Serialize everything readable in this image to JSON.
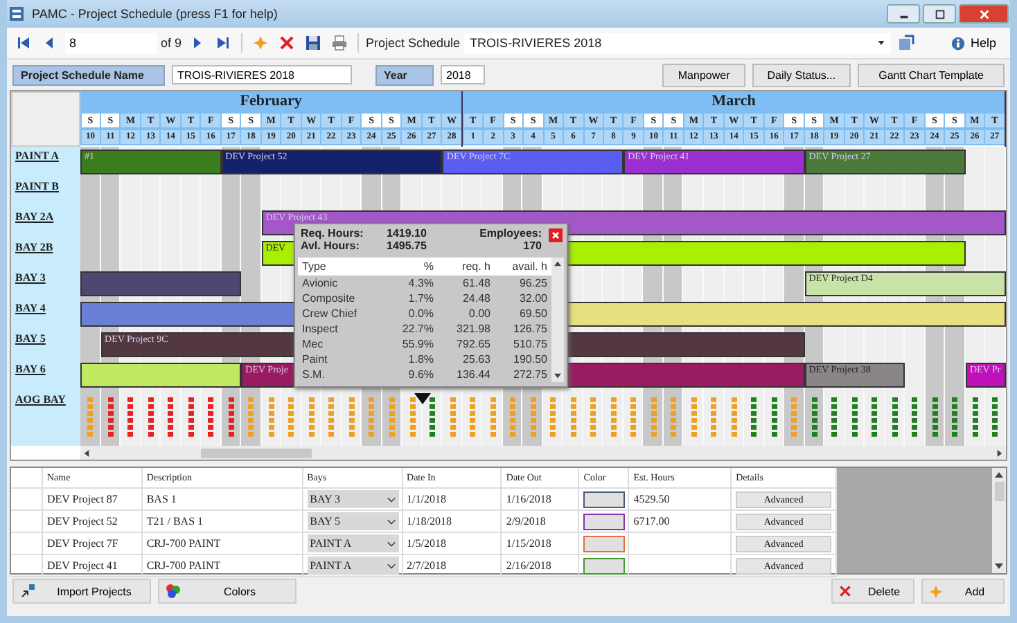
{
  "window": {
    "title": "PAMC - Project Schedule (press F1 for help)"
  },
  "toolbar": {
    "record": "8",
    "record_count": "of 9",
    "schedule_label": "Project Schedule",
    "schedule_value": "TROIS-RIVIERES 2018",
    "help": "Help"
  },
  "form": {
    "name_label": "Project Schedule Name",
    "name_value": "TROIS-RIVIERES 2018",
    "year_label": "Year",
    "year_value": "2018",
    "buttons": [
      "Manpower",
      "Daily Status...",
      "Gantt Chart Template"
    ]
  },
  "gantt": {
    "months": [
      {
        "name": "February",
        "days": [
          {
            "letter": "S",
            "number": "10",
            "weekend": true
          },
          {
            "letter": "S",
            "number": "11",
            "weekend": true
          },
          {
            "letter": "M",
            "number": "12",
            "weekend": false
          },
          {
            "letter": "T",
            "number": "13",
            "weekend": false
          },
          {
            "letter": "W",
            "number": "14",
            "weekend": false
          },
          {
            "letter": "T",
            "number": "15",
            "weekend": false
          },
          {
            "letter": "F",
            "number": "16",
            "weekend": false
          },
          {
            "letter": "S",
            "number": "17",
            "weekend": true
          },
          {
            "letter": "S",
            "number": "18",
            "weekend": true
          },
          {
            "letter": "M",
            "number": "19",
            "weekend": false
          },
          {
            "letter": "T",
            "number": "20",
            "weekend": false
          },
          {
            "letter": "W",
            "number": "21",
            "weekend": false
          },
          {
            "letter": "T",
            "number": "22",
            "weekend": false
          },
          {
            "letter": "F",
            "number": "23",
            "weekend": false
          },
          {
            "letter": "S",
            "number": "24",
            "weekend": true
          },
          {
            "letter": "S",
            "number": "25",
            "weekend": true
          },
          {
            "letter": "M",
            "number": "26",
            "weekend": false
          },
          {
            "letter": "T",
            "number": "27",
            "weekend": false
          },
          {
            "letter": "W",
            "number": "28",
            "weekend": false
          }
        ]
      },
      {
        "name": "March",
        "days": [
          {
            "letter": "T",
            "number": "1",
            "weekend": false
          },
          {
            "letter": "F",
            "number": "2",
            "weekend": false
          },
          {
            "letter": "S",
            "number": "3",
            "weekend": true
          },
          {
            "letter": "S",
            "number": "4",
            "weekend": true
          },
          {
            "letter": "M",
            "number": "5",
            "weekend": false
          },
          {
            "letter": "T",
            "number": "6",
            "weekend": false
          },
          {
            "letter": "W",
            "number": "7",
            "weekend": false
          },
          {
            "letter": "T",
            "number": "8",
            "weekend": false
          },
          {
            "letter": "F",
            "number": "9",
            "weekend": false
          },
          {
            "letter": "S",
            "number": "10",
            "weekend": true
          },
          {
            "letter": "S",
            "number": "11",
            "weekend": true
          },
          {
            "letter": "M",
            "number": "12",
            "weekend": false
          },
          {
            "letter": "T",
            "number": "13",
            "weekend": false
          },
          {
            "letter": "W",
            "number": "14",
            "weekend": false
          },
          {
            "letter": "T",
            "number": "15",
            "weekend": false
          },
          {
            "letter": "F",
            "number": "16",
            "weekend": false
          },
          {
            "letter": "S",
            "number": "17",
            "weekend": true
          },
          {
            "letter": "S",
            "number": "18",
            "weekend": true
          },
          {
            "letter": "M",
            "number": "19",
            "weekend": false
          },
          {
            "letter": "T",
            "number": "20",
            "weekend": false
          },
          {
            "letter": "W",
            "number": "21",
            "weekend": false
          },
          {
            "letter": "T",
            "number": "22",
            "weekend": false
          },
          {
            "letter": "F",
            "number": "23",
            "weekend": false
          },
          {
            "letter": "S",
            "number": "24",
            "weekend": true
          },
          {
            "letter": "S",
            "number": "25",
            "weekend": true
          },
          {
            "letter": "M",
            "number": "26",
            "weekend": false
          },
          {
            "letter": "T",
            "number": "27",
            "weekend": false
          }
        ]
      }
    ],
    "rows": [
      {
        "label": "PAINT A",
        "bars": [
          {
            "label": "#1",
            "color": "#3a7d1c"
          },
          {
            "label": "DEV Project 52",
            "color": "#14206a"
          },
          {
            "label": "DEV Project 7C",
            "color": "#5a5ef0"
          },
          {
            "label": "DEV Project 41",
            "color": "#9a30d0"
          },
          {
            "label": "DEV Project 27",
            "color": "#4a7a3a"
          }
        ]
      },
      {
        "label": "PAINT B",
        "bars": []
      },
      {
        "label": "BAY 2A",
        "bars": [
          {
            "label": "DEV Project 43",
            "color": "#a458c8"
          }
        ]
      },
      {
        "label": "BAY 2B",
        "bars": [
          {
            "label": "DEV",
            "color": "#a8f000"
          }
        ]
      },
      {
        "label": "BAY 3",
        "bars": [
          {
            "color": "#4e4870"
          },
          {
            "label": "DEV Project D4",
            "color": "#c8e2a8"
          }
        ]
      },
      {
        "label": "BAY 4",
        "bars": [
          {
            "color": "#6a80d8"
          },
          {
            "color": "#e8e080"
          }
        ]
      },
      {
        "label": "BAY 5",
        "bars": [
          {
            "label": "DEV Project 9C",
            "color": "#533842"
          }
        ]
      },
      {
        "label": "BAY 6",
        "bars": [
          {
            "color": "#c0e860"
          },
          {
            "label": "DEV Proje",
            "color": "#9a1c60"
          },
          {
            "label": "DEV Project 38",
            "color": "#8a8688"
          },
          {
            "label": "DEV Pr",
            "color": "#c010b8"
          }
        ]
      }
    ],
    "aog": {
      "label": "AOG BAY",
      "marks": [
        {
          "color": "#f0a020"
        },
        {
          "color": "#e82020"
        },
        {
          "color": "#e82020"
        },
        {
          "color": "#e82020"
        },
        {
          "color": "#e82020"
        },
        {
          "color": "#e82020"
        },
        {
          "color": "#e82020"
        },
        {
          "color": "#e82020"
        },
        {
          "color": "#f0a020"
        },
        {
          "color": "#f0a020"
        },
        {
          "color": "#f0a020"
        },
        {
          "color": "#f0a020"
        },
        {
          "color": "#f0a020"
        },
        {
          "color": "#f0a020"
        },
        {
          "color": "#f0a020"
        },
        {
          "color": "#f0a020"
        },
        {
          "color": "#f0a020"
        },
        {
          "color": "#208020"
        },
        {
          "color": "#f0a020"
        },
        {
          "color": "#f0a020"
        },
        {
          "color": "#f0a020"
        },
        {
          "color": "#f0a020"
        },
        {
          "color": "#f0a020"
        },
        {
          "color": "#f0a020"
        },
        {
          "color": "#f0a020"
        },
        {
          "color": "#f0a020"
        },
        {
          "color": "#f0a020"
        },
        {
          "color": "#f0a020"
        },
        {
          "color": "#f0a020"
        },
        {
          "color": "#f0a020"
        },
        {
          "color": "#f0a020"
        },
        {
          "color": "#f0a020"
        },
        {
          "color": "#f0a020"
        },
        {
          "color": "#208020"
        },
        {
          "color": "#208020"
        },
        {
          "color": "#f0a020"
        },
        {
          "color": "#208020"
        },
        {
          "color": "#208020"
        },
        {
          "color": "#208020"
        },
        {
          "color": "#208020"
        },
        {
          "color": "#208020"
        },
        {
          "color": "#208020"
        },
        {
          "color": "#208020"
        },
        {
          "color": "#208020"
        },
        {
          "color": "#208020"
        },
        {
          "color": "#208020"
        }
      ]
    },
    "popup": {
      "req_label": "Req. Hours:",
      "req_value": "1419.10",
      "avl_label": "Avl. Hours:",
      "avl_value": "1495.75",
      "emp_label": "Employees:",
      "emp_value": "170",
      "columns": [
        "Type",
        "%",
        "req. h",
        "avail. h"
      ],
      "rows": [
        [
          "Avionic",
          "4.3%",
          "61.48",
          "96.25"
        ],
        [
          "Composite",
          "1.7%",
          "24.48",
          "32.00"
        ],
        [
          "Crew Chief",
          "0.0%",
          "0.00",
          "69.50"
        ],
        [
          "Inspect",
          "22.7%",
          "321.98",
          "126.75"
        ],
        [
          "Mec",
          "55.9%",
          "792.65",
          "510.75"
        ],
        [
          "Paint",
          "1.8%",
          "25.63",
          "190.50"
        ],
        [
          "S.M.",
          "9.6%",
          "136.44",
          "272.75"
        ]
      ]
    }
  },
  "grid": {
    "columns": [
      "Name",
      "Description",
      "Bays",
      "Date In",
      "Date Out",
      "Color",
      "Est. Hours",
      "Details"
    ],
    "rows": [
      {
        "name": "DEV Project 87",
        "description": "BAS 1",
        "bay": "BAY 3",
        "date_in": "1/1/2018",
        "date_out": "1/16/2018",
        "color": "#4a5a7a",
        "hours": "4529.50",
        "details": "Advanced"
      },
      {
        "name": "DEV Project 52",
        "description": "T21 / BAS 1",
        "bay": "BAY 5",
        "date_in": "1/18/2018",
        "date_out": "2/9/2018",
        "color": "#8a30b0",
        "hours": "6717.00",
        "details": "Advanced"
      },
      {
        "name": "DEV Project 7F",
        "description": "CRJ-700 PAINT",
        "bay": "PAINT A",
        "date_in": "1/5/2018",
        "date_out": "1/15/2018",
        "color": "#e07040",
        "details": "Advanced"
      },
      {
        "name": "DEV Project 41",
        "description": "CRJ-700 PAINT",
        "bay": "PAINT A",
        "date_in": "2/7/2018",
        "date_out": "2/16/2018",
        "color": "#40a030",
        "details": "Advanced"
      }
    ]
  },
  "bottom": {
    "import": "Import Projects",
    "colors": "Colors",
    "delete": "Delete",
    "add": "Add"
  }
}
